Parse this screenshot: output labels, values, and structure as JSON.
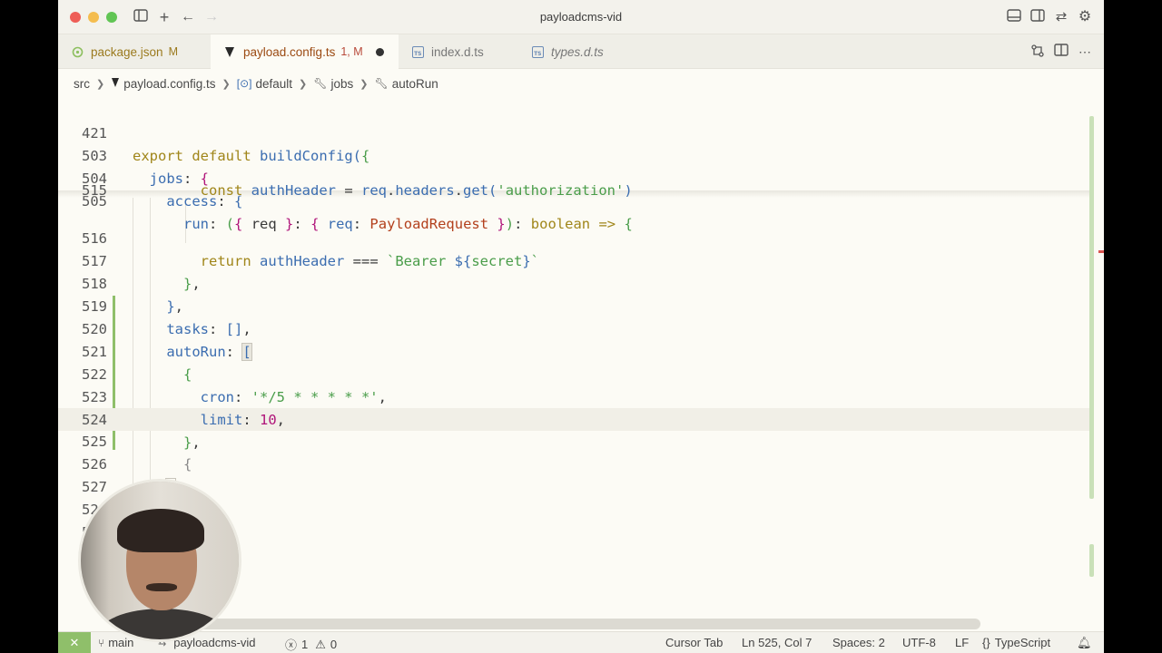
{
  "window": {
    "title": "payloadcms-vid"
  },
  "tabs": [
    {
      "label": "package.json",
      "badge": "M",
      "icon": "json-icon",
      "active": false,
      "italic": false
    },
    {
      "label": "payload.config.ts",
      "badge": "1, M",
      "icon": "ts-icon",
      "active": true,
      "dirty": true
    },
    {
      "label": "index.d.ts",
      "badge": "",
      "icon": "ts-icon",
      "active": false
    },
    {
      "label": "types.d.ts",
      "badge": "",
      "icon": "ts-icon",
      "active": false,
      "italic": true
    }
  ],
  "breadcrumb": [
    "src",
    "payload.config.ts",
    "default",
    "jobs",
    "autoRun"
  ],
  "sticky_lines": [
    {
      "num": "421",
      "text": "export default buildConfig({"
    },
    {
      "num": "503",
      "text": "  jobs: {"
    },
    {
      "num": "504",
      "text": "    access: {"
    },
    {
      "num": "505",
      "text": "      run: ({ req }: { req: PayloadRequest }): boolean => {"
    }
  ],
  "lines": [
    {
      "num": "515",
      "text": "        const authHeader = req.headers.get('authorization')"
    },
    {
      "num": "516",
      "text": "        return authHeader === `Bearer ${secret}`"
    },
    {
      "num": "517",
      "text": "      },"
    },
    {
      "num": "518",
      "text": "    },"
    },
    {
      "num": "519",
      "text": "    tasks: [],"
    },
    {
      "num": "520",
      "text": "    autoRun: ["
    },
    {
      "num": "521",
      "text": "      {"
    },
    {
      "num": "522",
      "text": "        cron: '*/5 * * * * *',"
    },
    {
      "num": "523",
      "text": "        limit: 10,"
    },
    {
      "num": "524",
      "text": "      },"
    },
    {
      "num": "525",
      "text": "      {"
    },
    {
      "num": "526",
      "text": "    ]"
    },
    {
      "num": "527",
      "text": "  },"
    },
    {
      "num": "528",
      "text": ""
    },
    {
      "num": "529",
      "text": ""
    }
  ],
  "statusbar": {
    "branch": "main",
    "workspace": "payloadcms-vid",
    "errors": "1",
    "warnings": "0",
    "cursor_tab": "Cursor Tab",
    "position": "Ln 525, Col 7",
    "spaces": "Spaces: 2",
    "encoding": "UTF-8",
    "eol": "LF",
    "language": "TypeScript"
  },
  "colors": {
    "accent_green": "#8fbf6a",
    "editor_bg": "#fcfbf5",
    "error_red": "#d9534f"
  }
}
